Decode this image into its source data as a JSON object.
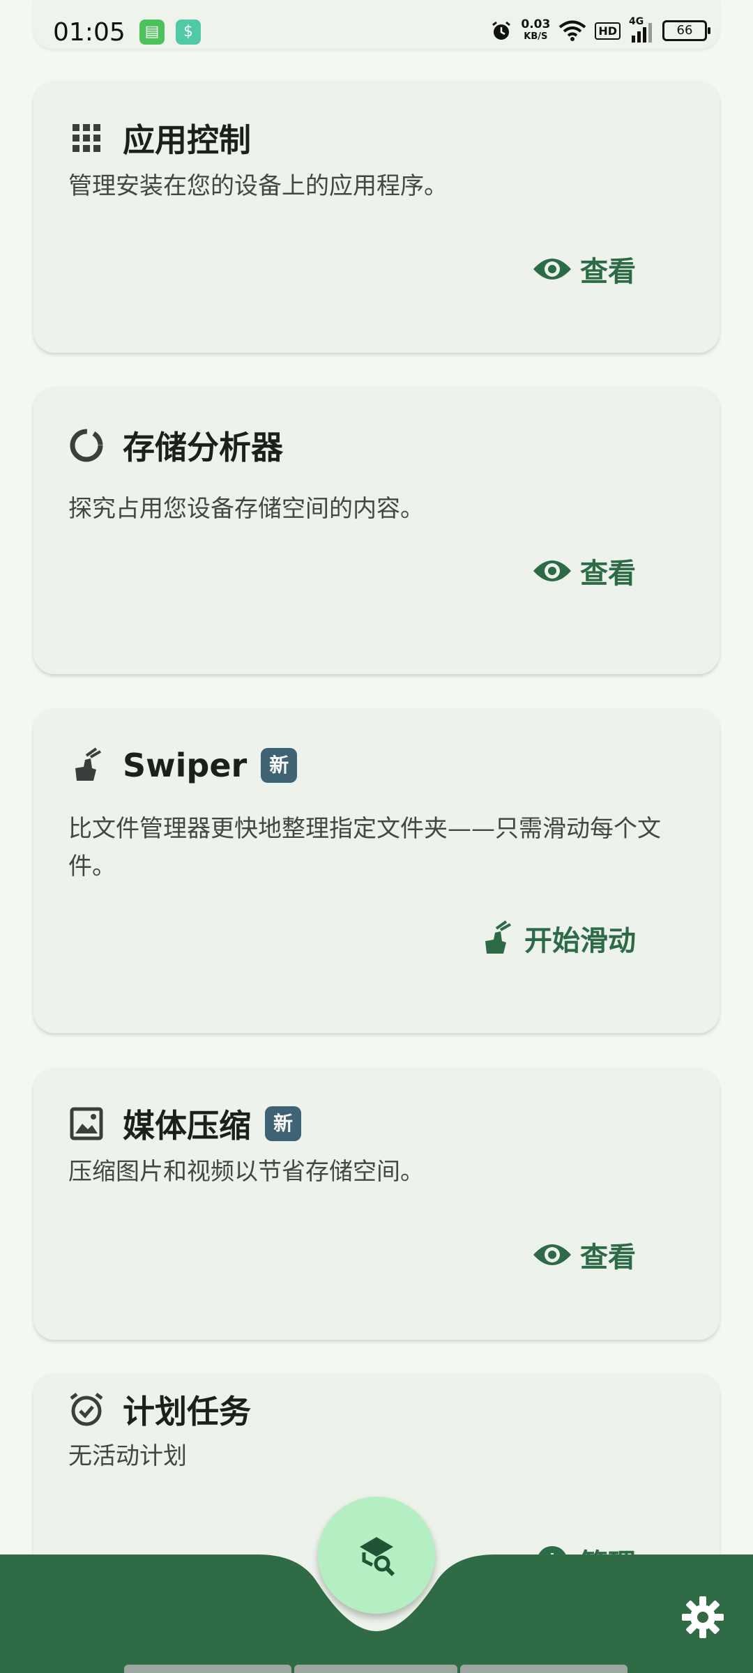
{
  "status_bar": {
    "time": "01:05",
    "net_speed_value": "0.03",
    "net_speed_unit": "KB/S",
    "hd_label": "HD",
    "signal_label": "4G",
    "battery_level": "66"
  },
  "cards": [
    {
      "title": "应用控制",
      "description": "管理安装在您的设备上的应用程序。",
      "action_label": "查看",
      "icon": "grid-icon"
    },
    {
      "title": "存储分析器",
      "description": "探究占用您设备存储空间的内容。",
      "action_label": "查看",
      "icon": "donut-chart-icon"
    },
    {
      "title": "Swiper",
      "badge": "新",
      "description": "比文件管理器更快地整理指定文件夹——只需滑动每个文件。",
      "action_label": "开始滑动",
      "icon": "swipe-icon"
    },
    {
      "title": "媒体压缩",
      "badge": "新",
      "description": "压缩图片和视频以节省存储空间。",
      "action_label": "查看",
      "icon": "image-icon"
    },
    {
      "title": "计划任务",
      "description": "无活动计划",
      "action_label": "管理",
      "icon": "alarm-icon"
    }
  ],
  "colors": {
    "background": "#f3f8f1",
    "card": "#edf3eb",
    "accent": "#2d6a46",
    "bottom_bar": "#2f6b44",
    "fab": "#b4efc3",
    "badge": "#3d6375"
  }
}
